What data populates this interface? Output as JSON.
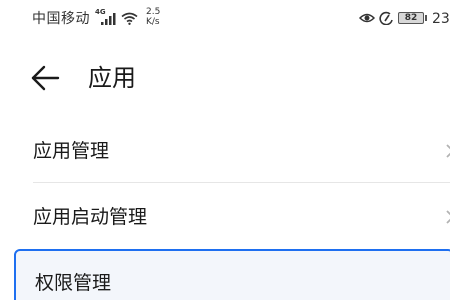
{
  "status_bar": {
    "carrier": "中国移动",
    "network_type": "4G",
    "speed_value": "2.5",
    "speed_unit": "K/s",
    "battery": "82",
    "time": "23"
  },
  "header": {
    "title": "应用"
  },
  "menu": {
    "items": [
      {
        "label": "应用管理"
      },
      {
        "label": "应用启动管理"
      },
      {
        "label": "权限管理"
      }
    ]
  },
  "colors": {
    "accent": "#1e6ff0",
    "text": "#1a1a1a",
    "divider": "#e6e6e6"
  }
}
